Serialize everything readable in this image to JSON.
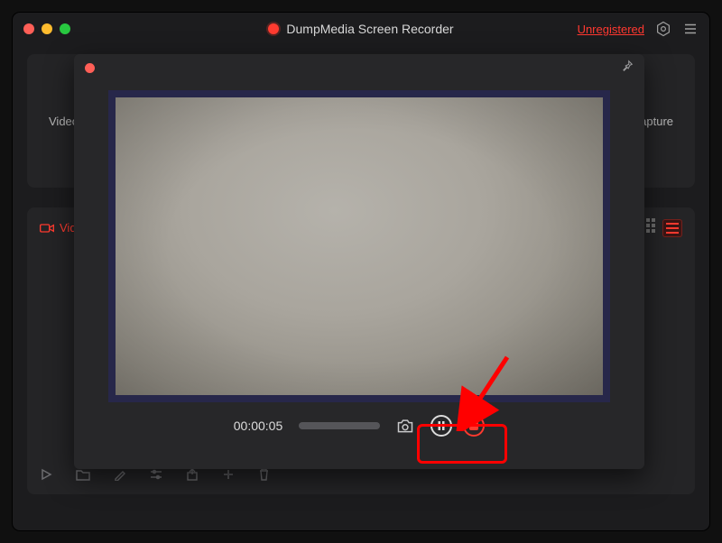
{
  "app": {
    "title": "DumpMedia Screen Recorder",
    "license_label": "Unregistered"
  },
  "main": {
    "mode_left_label": "Video",
    "mode_right_label": "Capture",
    "tab_label": "Video"
  },
  "recording": {
    "timer": "00:00:05"
  }
}
